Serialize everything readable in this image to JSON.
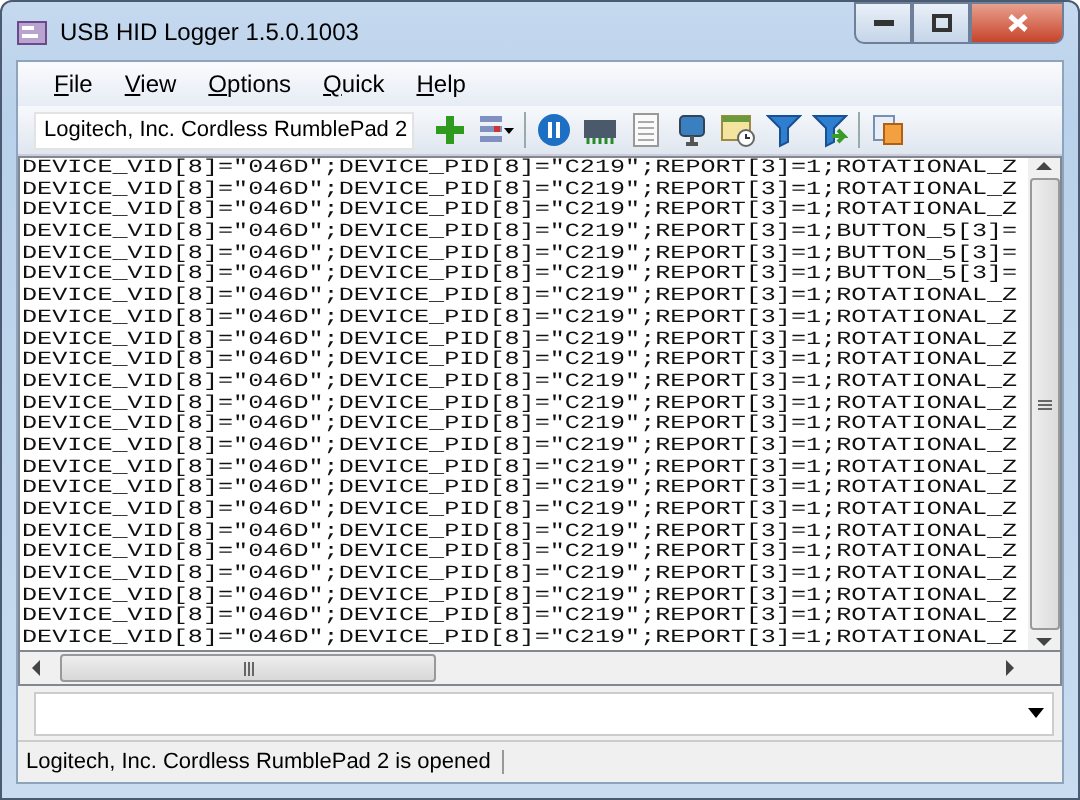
{
  "window": {
    "title": "USB HID Logger 1.5.0.1003"
  },
  "menu": [
    "File",
    "View",
    "Options",
    "Quick",
    "Help"
  ],
  "toolbar": {
    "device": "Logitech, Inc. Cordless RumblePad 2"
  },
  "log": [
    "DEVICE_VID[8]=\"046D\";DEVICE_PID[8]=\"C219\";REPORT[3]=1;ROTATIONAL_Z",
    "DEVICE_VID[8]=\"046D\";DEVICE_PID[8]=\"C219\";REPORT[3]=1;ROTATIONAL_Z",
    "DEVICE_VID[8]=\"046D\";DEVICE_PID[8]=\"C219\";REPORT[3]=1;ROTATIONAL_Z",
    "DEVICE_VID[8]=\"046D\";DEVICE_PID[8]=\"C219\";REPORT[3]=1;BUTTON_5[3]=",
    "DEVICE_VID[8]=\"046D\";DEVICE_PID[8]=\"C219\";REPORT[3]=1;BUTTON_5[3]=",
    "DEVICE_VID[8]=\"046D\";DEVICE_PID[8]=\"C219\";REPORT[3]=1;BUTTON_5[3]=",
    "DEVICE_VID[8]=\"046D\";DEVICE_PID[8]=\"C219\";REPORT[3]=1;ROTATIONAL_Z",
    "DEVICE_VID[8]=\"046D\";DEVICE_PID[8]=\"C219\";REPORT[3]=1;ROTATIONAL_Z",
    "DEVICE_VID[8]=\"046D\";DEVICE_PID[8]=\"C219\";REPORT[3]=1;ROTATIONAL_Z",
    "DEVICE_VID[8]=\"046D\";DEVICE_PID[8]=\"C219\";REPORT[3]=1;ROTATIONAL_Z",
    "DEVICE_VID[8]=\"046D\";DEVICE_PID[8]=\"C219\";REPORT[3]=1;ROTATIONAL_Z",
    "DEVICE_VID[8]=\"046D\";DEVICE_PID[8]=\"C219\";REPORT[3]=1;ROTATIONAL_Z",
    "DEVICE_VID[8]=\"046D\";DEVICE_PID[8]=\"C219\";REPORT[3]=1;ROTATIONAL_Z",
    "DEVICE_VID[8]=\"046D\";DEVICE_PID[8]=\"C219\";REPORT[3]=1;ROTATIONAL_Z",
    "DEVICE_VID[8]=\"046D\";DEVICE_PID[8]=\"C219\";REPORT[3]=1;ROTATIONAL_Z",
    "DEVICE_VID[8]=\"046D\";DEVICE_PID[8]=\"C219\";REPORT[3]=1;ROTATIONAL_Z",
    "DEVICE_VID[8]=\"046D\";DEVICE_PID[8]=\"C219\";REPORT[3]=1;ROTATIONAL_Z",
    "DEVICE_VID[8]=\"046D\";DEVICE_PID[8]=\"C219\";REPORT[3]=1;ROTATIONAL_Z",
    "DEVICE_VID[8]=\"046D\";DEVICE_PID[8]=\"C219\";REPORT[3]=1;ROTATIONAL_Z",
    "DEVICE_VID[8]=\"046D\";DEVICE_PID[8]=\"C219\";REPORT[3]=1;ROTATIONAL_Z",
    "DEVICE_VID[8]=\"046D\";DEVICE_PID[8]=\"C219\";REPORT[3]=1;ROTATIONAL_Z",
    "DEVICE_VID[8]=\"046D\";DEVICE_PID[8]=\"C219\";REPORT[3]=1;ROTATIONAL_Z",
    "DEVICE_VID[8]=\"046D\";DEVICE_PID[8]=\"C219\";REPORT[3]=1;ROTATIONAL_Z"
  ],
  "status_bar": "Logitech, Inc. Cordless RumblePad 2 is opened"
}
